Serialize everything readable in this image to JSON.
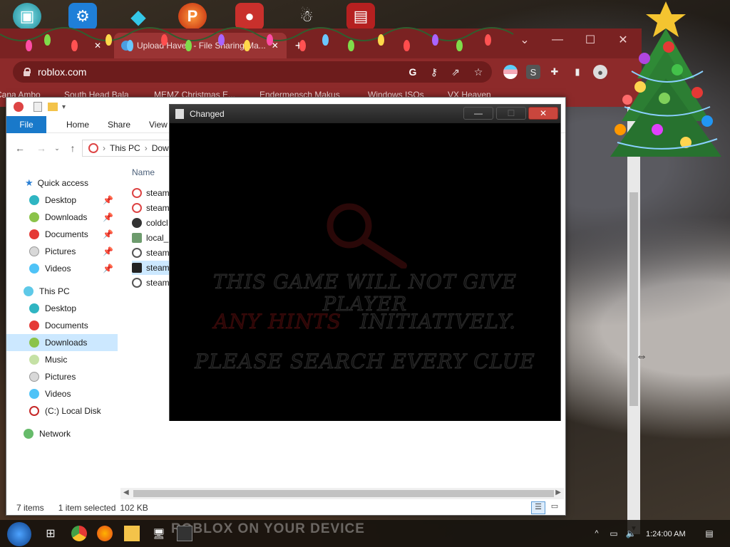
{
  "browser": {
    "tabs": [
      {
        "label": "Upload Haven - File Sharing Ma..."
      }
    ],
    "url": "roblox.com",
    "bookmarks": [
      "Cana Ambo",
      "South Head Bala",
      "MEMZ Christmas E...",
      "Endermensch Makus",
      "Windows ISOs",
      "VX Heaven"
    ],
    "ext_letter": "S"
  },
  "explorer": {
    "ribbon": {
      "file": "File",
      "home": "Home",
      "share": "Share",
      "view": "View"
    },
    "address": {
      "this_pc": "This PC",
      "current": "Dow"
    },
    "nav": {
      "quick_access": "Quick access",
      "qa_items": [
        "Desktop",
        "Downloads",
        "Documents",
        "Pictures",
        "Videos"
      ],
      "this_pc": "This PC",
      "pc_items": [
        "Desktop",
        "Documents",
        "Downloads",
        "Music",
        "Pictures",
        "Videos",
        "(C:) Local Disk"
      ],
      "network": "Network"
    },
    "column_name": "Name",
    "files": [
      "steam",
      "steam",
      "coldcl",
      "local_",
      "steam",
      "steam",
      "steam"
    ],
    "status": {
      "count": "7 items",
      "selected": "1 item selected",
      "size": "102 KB"
    }
  },
  "game": {
    "title": "Changed",
    "line1": "THIS GAME WILL NOT GIVE PLAYER",
    "line2a": "ANY HINTS",
    "line2b": "INITIATIVELY.",
    "line3": "PLEASE SEARCH EVERY CLUE"
  },
  "taskbar": {
    "watermark": "ROBLOX ON YOUR DEVICE",
    "time": "1:24:00 AM"
  },
  "colors": {
    "chrome_frame": "#8d2a2a",
    "explorer_file_tab": "#1979ca",
    "selection": "#cce8ff",
    "close_button": "#c9463d"
  }
}
